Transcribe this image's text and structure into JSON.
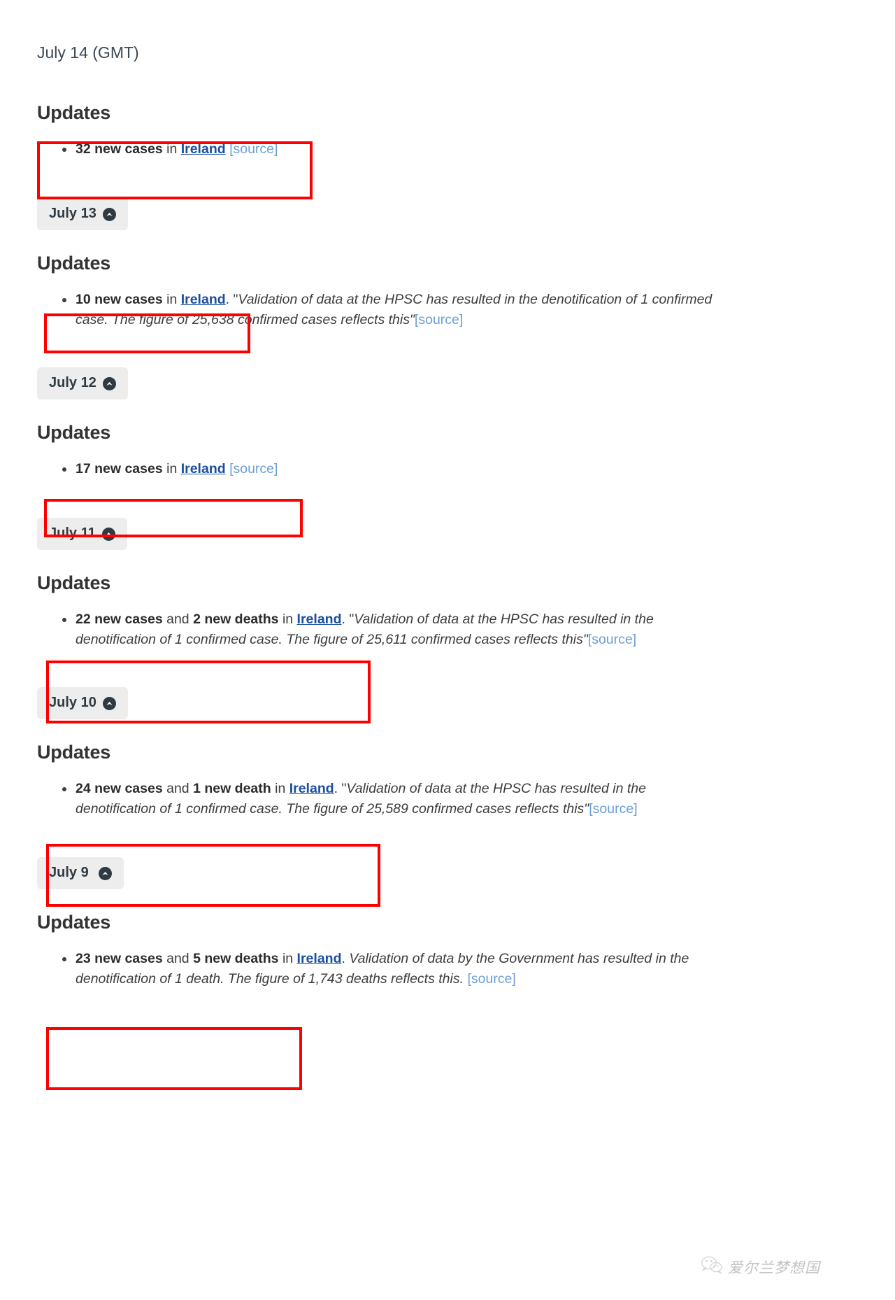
{
  "page": {
    "top_date": "July 14 (GMT)",
    "updates_heading": "Updates",
    "source_label": "source",
    "country_label": "Ireland",
    "watermark_text": "爱尔兰梦想国",
    "watermark_icon": "wechat-icon",
    "chevron_icon": "chevron-up-circle-icon",
    "accent_red": "#ff0000",
    "link_blue": "#1a4fa0",
    "source_blue": "#6b9fd4",
    "badge_bg": "#ededed"
  },
  "entries": [
    {
      "id": "july-14",
      "date_label": "July 14 (GMT)",
      "is_header_date": true,
      "updates_heading": "Updates",
      "bullets": [
        {
          "cases": "32 new cases",
          "connector_in": " in ",
          "country": "Ireland",
          "after_country": " ",
          "quote": "",
          "source": "source"
        }
      ]
    },
    {
      "id": "july-13",
      "date_label": "July 13",
      "updates_heading": "Updates",
      "bullets": [
        {
          "cases": "10 new cases",
          "connector_in": " in ",
          "country": "Ireland",
          "after_country": ". \"",
          "quote": "Validation of data at the HPSC has resulted in the denotification of 1 confirmed case. The figure of 25,638 confirmed cases reflects this\"",
          "source": "source"
        }
      ]
    },
    {
      "id": "july-12",
      "date_label": "July 12",
      "updates_heading": "Updates",
      "bullets": [
        {
          "cases": "17 new cases",
          "connector_in": " in ",
          "country": "Ireland",
          "after_country": " ",
          "quote": "",
          "source": "source"
        }
      ]
    },
    {
      "id": "july-11",
      "date_label": "July 11",
      "updates_heading": "Updates",
      "bullets": [
        {
          "cases": "22 new cases",
          "connector_and": " and ",
          "deaths": "2 new deaths",
          "connector_in": " in ",
          "country": "Ireland",
          "after_country": ". \"",
          "quote": "Validation of data at the HPSC has resulted in the denotification of 1 confirmed case. The figure of 25,611 confirmed cases reflects this\"",
          "source": "source"
        }
      ]
    },
    {
      "id": "july-10",
      "date_label": "July 10",
      "updates_heading": "Updates",
      "bullets": [
        {
          "cases": "24 new cases",
          "connector_and": " and ",
          "deaths": "1 new death",
          "connector_in": " in ",
          "country": "Ireland",
          "after_country": ". \"",
          "quote": "Validation of data at the HPSC has resulted in the denotification of 1 confirmed case. The figure of 25,589 confirmed cases reflects this\"",
          "source": "source"
        }
      ]
    },
    {
      "id": "july-9",
      "date_label": "July 9 ",
      "updates_heading": "Updates",
      "bullets": [
        {
          "cases": "23 new cases",
          "connector_and": " and ",
          "deaths": "5 new deaths",
          "connector_in": " in ",
          "country": "Ireland",
          "after_country": ". ",
          "quote": "Validation of data by the Government has resulted in the denotification of 1 death. The figure of 1,743 deaths reflects this. ",
          "source": "source"
        }
      ]
    }
  ]
}
